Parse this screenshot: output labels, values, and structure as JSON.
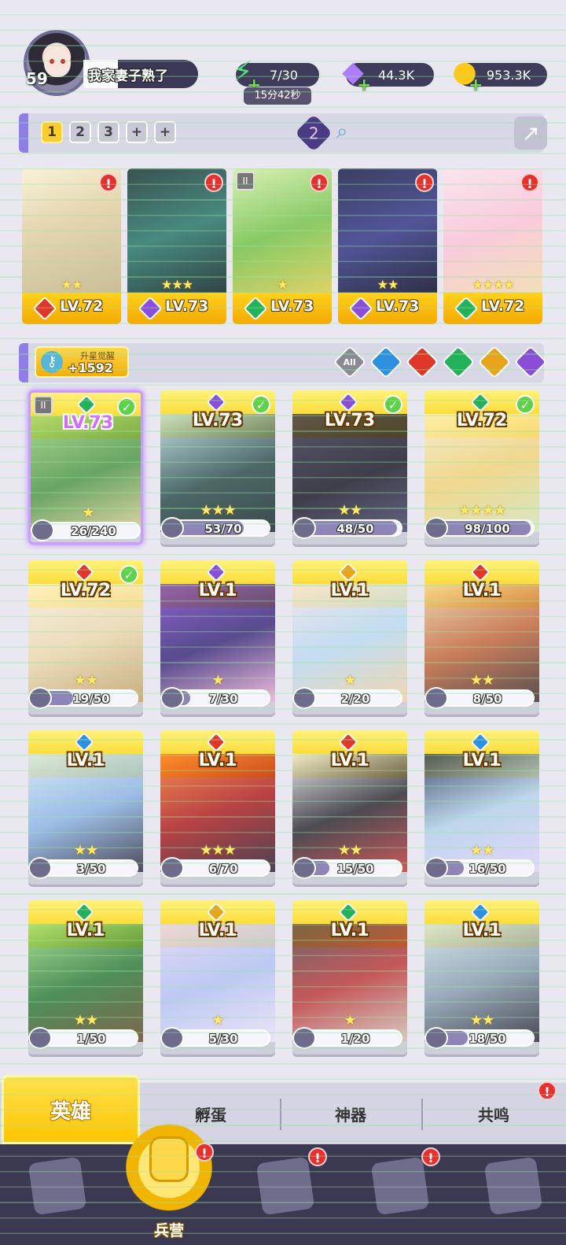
{
  "player": {
    "level": "59",
    "name": "我家妻子熟了"
  },
  "resources": {
    "energy": "7/30",
    "energy_timer": "15分42秒",
    "gems": "44.3K",
    "gold": "953.3K"
  },
  "team_tabs": [
    "1",
    "2",
    "3",
    "+",
    "+"
  ],
  "team_pet_level": "2",
  "team": [
    {
      "level": "LV.72",
      "element": "fire",
      "stars": "★★"
    },
    {
      "level": "LV.73",
      "element": "dark",
      "stars": "★★★"
    },
    {
      "level": "LV.73",
      "element": "wind",
      "stars": "★"
    },
    {
      "level": "LV.73",
      "element": "dark",
      "stars": "★★"
    },
    {
      "level": "LV.72",
      "element": "wind",
      "stars": "★★★★"
    }
  ],
  "star_awaken": {
    "label": "升星觉醒",
    "value": "+1592"
  },
  "filters": [
    "All",
    "water",
    "fire",
    "wind",
    "light",
    "dark"
  ],
  "filter_all_label": "All",
  "heroes": [
    {
      "level": "LV.73",
      "element": "wind",
      "shards": "26/240",
      "progress": 0.108,
      "stars": "★",
      "checked": true
    },
    {
      "level": "LV.73",
      "element": "dark",
      "shards": "53/70",
      "progress": 0.757,
      "stars": "★★★",
      "checked": true
    },
    {
      "level": "LV.73",
      "element": "dark",
      "shards": "48/50",
      "progress": 0.96,
      "stars": "★★",
      "checked": true
    },
    {
      "level": "LV.72",
      "element": "wind",
      "shards": "98/100",
      "progress": 0.98,
      "stars": "★★★★",
      "checked": true
    },
    {
      "level": "LV.72",
      "element": "fire",
      "shards": "19/50",
      "progress": 0.38,
      "stars": "★★",
      "checked": true
    },
    {
      "level": "LV.1",
      "element": "dark",
      "shards": "7/30",
      "progress": 0.233,
      "stars": "★",
      "checked": false
    },
    {
      "level": "LV.1",
      "element": "light",
      "shards": "2/20",
      "progress": 0.1,
      "stars": "★",
      "checked": false
    },
    {
      "level": "LV.1",
      "element": "fire",
      "shards": "8/50",
      "progress": 0.16,
      "stars": "★★",
      "checked": false
    },
    {
      "level": "LV.1",
      "element": "water",
      "shards": "3/50",
      "progress": 0.06,
      "stars": "★★",
      "checked": false
    },
    {
      "level": "LV.1",
      "element": "fire",
      "shards": "6/70",
      "progress": 0.086,
      "stars": "★★★",
      "checked": false
    },
    {
      "level": "LV.1",
      "element": "fire",
      "shards": "15/50",
      "progress": 0.3,
      "stars": "★★",
      "checked": false
    },
    {
      "level": "LV.1",
      "element": "water",
      "shards": "16/50",
      "progress": 0.32,
      "stars": "★★",
      "checked": false
    },
    {
      "level": "LV.1",
      "element": "wind",
      "shards": "1/50",
      "progress": 0.02,
      "stars": "★★",
      "checked": false
    },
    {
      "level": "LV.1",
      "element": "light",
      "shards": "5/30",
      "progress": 0.167,
      "stars": "★",
      "checked": false
    },
    {
      "level": "LV.1",
      "element": "wind",
      "shards": "1/20",
      "progress": 0.05,
      "stars": "★",
      "checked": false
    },
    {
      "level": "LV.1",
      "element": "water",
      "shards": "18/50",
      "progress": 0.36,
      "stars": "★★",
      "checked": false
    }
  ],
  "sub_tabs": [
    "英雄",
    "孵蛋",
    "神器",
    "共鸣"
  ],
  "nav": {
    "active_label": "兵营"
  },
  "colors": {
    "fire": "#e0372b",
    "water": "#2f8fe0",
    "wind": "#23b25b",
    "light": "#e6a51b",
    "dark": "#8a4fd6",
    "gold_card": "#f9c800",
    "accent_purple": "#8e7ee5"
  }
}
